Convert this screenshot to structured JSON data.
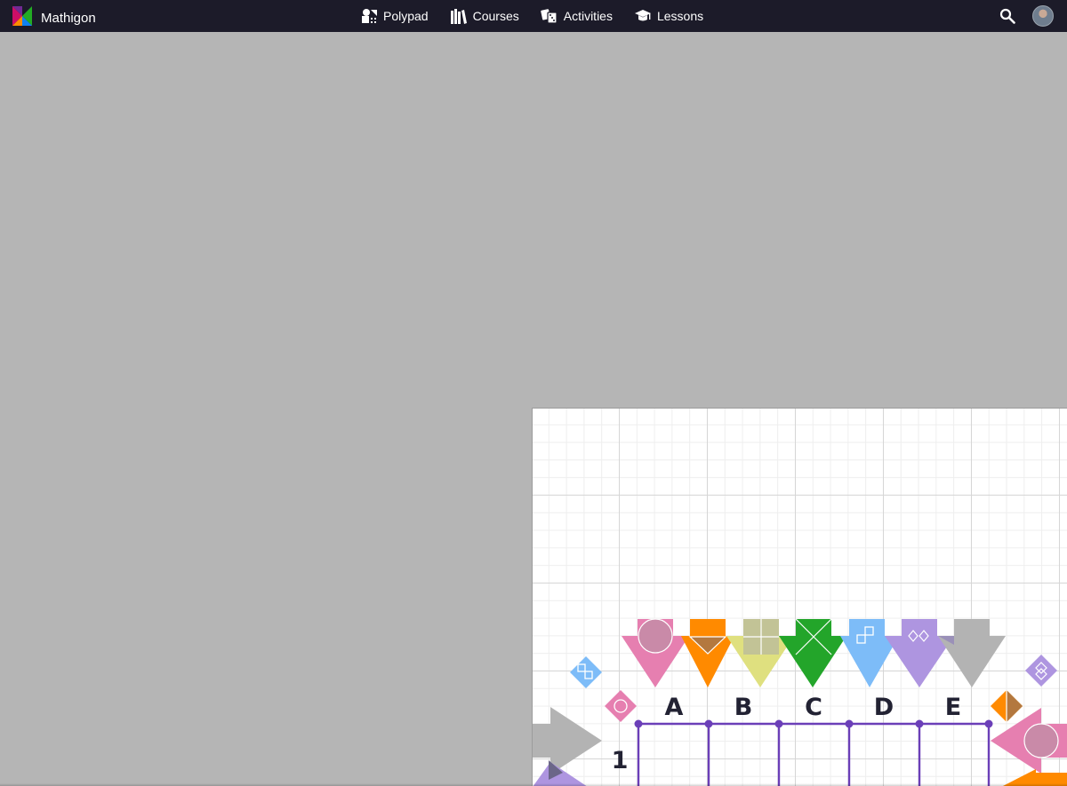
{
  "app": {
    "name": "Mathigon",
    "logo_colors": [
      "#cd0e66",
      "#0f82f2",
      "#22ab24",
      "#fd8c00"
    ]
  },
  "nav": {
    "items": [
      {
        "label": "Polypad",
        "icon": "polypad-icon"
      },
      {
        "label": "Courses",
        "icon": "courses-icon"
      },
      {
        "label": "Activities",
        "icon": "activities-icon"
      },
      {
        "label": "Lessons",
        "icon": "lessons-icon"
      }
    ]
  },
  "header": {
    "search_icon": "search-icon",
    "avatar_icon": "avatar-icon"
  },
  "canvas": {
    "column_labels": [
      "A",
      "B",
      "C",
      "D",
      "E"
    ],
    "row_labels": [
      "1"
    ],
    "shape_colors": {
      "pink": "#e67fb0",
      "orange": "#ff8a00",
      "yellow": "#dfe07f",
      "green": "#23a52a",
      "blue": "#7dbcf8",
      "purple": "#ae95e0",
      "gray": "#b3b3b3",
      "grid_line": "#6b3fb8"
    }
  }
}
